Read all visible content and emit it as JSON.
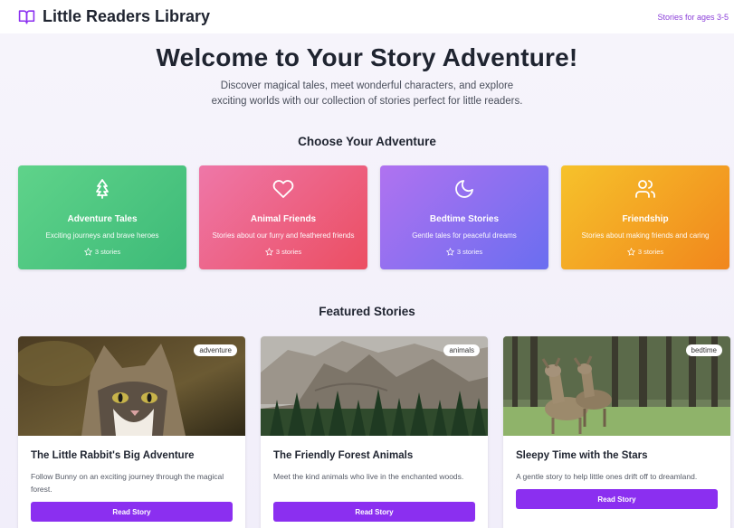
{
  "header": {
    "title": "Little Readers Library",
    "ages_label": "Stories for ages 3-5",
    "accent_color": "#8b2ff0"
  },
  "hero": {
    "title": "Welcome to Your Story Adventure!",
    "subtitle": "Discover magical tales, meet wonderful characters, and explore exciting worlds with our collection of stories perfect for little readers."
  },
  "categories_section": {
    "title": "Choose Your Adventure",
    "items": [
      {
        "icon": "tree-icon",
        "title": "Adventure Tales",
        "description": "Exciting journeys and brave heroes",
        "count": "3 stories",
        "color_from": "#5fd38a",
        "color_to": "#3dba78"
      },
      {
        "icon": "heart-icon",
        "title": "Animal Friends",
        "description": "Stories about our furry and feathered friends",
        "count": "3 stories",
        "color_from": "#ee77a8",
        "color_to": "#ec4e62"
      },
      {
        "icon": "moon-icon",
        "title": "Bedtime Stories",
        "description": "Gentle tales for peaceful dreams",
        "count": "3 stories",
        "color_from": "#b072f0",
        "color_to": "#6a6ef0"
      },
      {
        "icon": "users-icon",
        "title": "Friendship",
        "description": "Stories about making friends and caring",
        "count": "3 stories",
        "color_from": "#f6c22b",
        "color_to": "#f1861c"
      }
    ]
  },
  "featured_section": {
    "title": "Featured Stories",
    "stories": [
      {
        "tag": "adventure",
        "title": "The Little Rabbit's Big Adventure",
        "description": "Follow Bunny on an exciting journey through the magical forest.",
        "button": "Read Story"
      },
      {
        "tag": "animals",
        "title": "The Friendly Forest Animals",
        "description": "Meet the kind animals who live in the enchanted woods.",
        "button": "Read Story"
      },
      {
        "tag": "bedtime",
        "title": "Sleepy Time with the Stars",
        "description": "A gentle story to help little ones drift off to dreamland.",
        "button": "Read Story"
      }
    ]
  }
}
